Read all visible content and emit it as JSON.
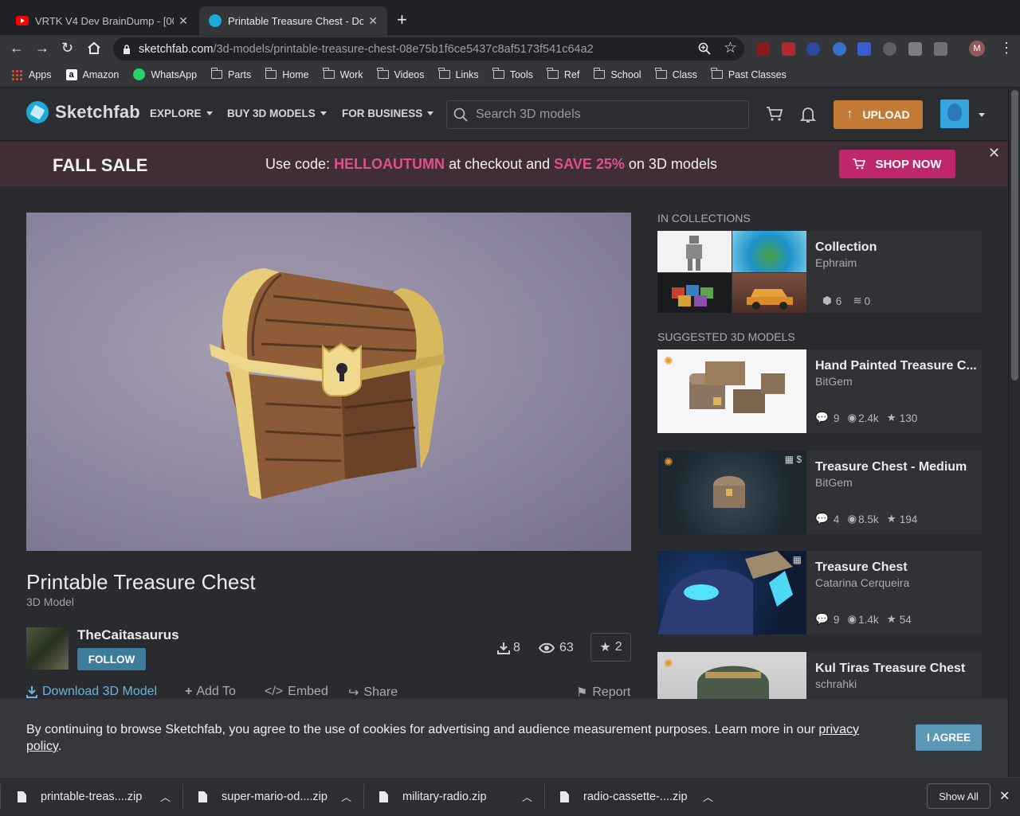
{
  "browser": {
    "tabs": [
      {
        "title": "VRTK V4 Dev BrainDump - [00"
      },
      {
        "title": "Printable Treasure Chest - Dow"
      }
    ],
    "url_host": "sketchfab.com",
    "url_path": "/3d-models/printable-treasure-chest-08e75b1f6ce5437c8af5173f541c64a2",
    "profile_initial": "M",
    "bookmarks": [
      "Apps",
      "Amazon",
      "WhatsApp",
      "Parts",
      "Home",
      "Work",
      "Videos",
      "Links",
      "Tools",
      "Ref",
      "School",
      "Class",
      "Past Classes"
    ]
  },
  "header": {
    "logo": "Sketchfab",
    "nav": [
      "EXPLORE",
      "BUY 3D MODELS",
      "FOR BUSINESS"
    ],
    "search_placeholder": "Search 3D models",
    "upload": "UPLOAD"
  },
  "sale": {
    "title": "FALL SALE",
    "msg_1": "Use code:",
    "code": "HELLOAUTUMN",
    "msg_2": "at checkout and",
    "save": "SAVE 25%",
    "msg_3": "on 3D models",
    "button": "SHOP NOW"
  },
  "model": {
    "title": "Printable Treasure Chest",
    "type": "3D Model",
    "author": "TheCaitasaurus",
    "follow": "FOLLOW",
    "downloads": "8",
    "views": "63",
    "likes": "2",
    "actions": {
      "download": "Download 3D Model",
      "add": "Add To",
      "embed": "Embed",
      "share": "Share",
      "report": "Report"
    }
  },
  "collections": {
    "heading": "IN COLLECTIONS",
    "items": [
      {
        "title": "Collection",
        "author": "Ephraim",
        "models": "6",
        "followers": "0"
      }
    ]
  },
  "suggested": {
    "heading": "SUGGESTED 3D MODELS",
    "items": [
      {
        "title": "Hand Painted Treasure C...",
        "author": "BitGem",
        "comments": "9",
        "views": "2.4k",
        "likes": "130"
      },
      {
        "title": "Treasure Chest - Medium",
        "author": "BitGem",
        "comments": "4",
        "views": "8.5k",
        "likes": "194"
      },
      {
        "title": "Treasure Chest",
        "author": "Catarina Cerqueira",
        "comments": "9",
        "views": "1.4k",
        "likes": "54"
      },
      {
        "title": "Kul Tiras Treasure Chest",
        "author": "schrahki"
      }
    ]
  },
  "cookie": {
    "text": "By continuing to browse Sketchfab, you agree to the use of cookies for advertising and audience measurement purposes. Learn more in our",
    "link": "privacy policy",
    "end": ".",
    "button": "I AGREE"
  },
  "downloads_shelf": {
    "files": [
      "printable-treas....zip",
      "super-mario-od....zip",
      "military-radio.zip",
      "radio-cassette-....zip"
    ],
    "show_all": "Show All"
  },
  "colors": {
    "accent": "#1caad9",
    "upload": "#c37a35",
    "sale_pink": "#e0508f",
    "shop_button": "#c0276a",
    "follow": "#3d7c9b"
  }
}
